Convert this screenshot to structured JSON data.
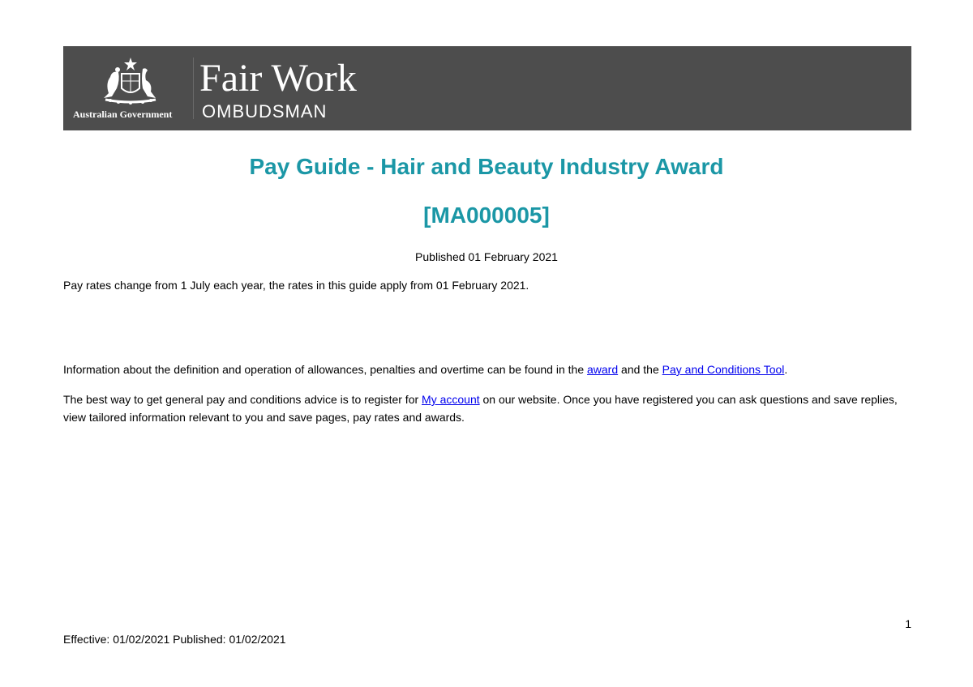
{
  "header": {
    "government_label": "Australian Government",
    "brand_line1": "Fair Work",
    "brand_line2": "OMBUDSMAN",
    "background_color": "#4d4d4d"
  },
  "title": {
    "line1": "Pay Guide - Hair and Beauty Industry Award",
    "line2": "[MA000005]",
    "color": "#1b97a6"
  },
  "published": "Published 01 February 2021",
  "paragraph1": "Pay rates change from 1 July each year, the rates in this guide apply from 01 February 2021.",
  "paragraph2": {
    "before": "Information about the definition and operation of allowances, penalties and overtime can be found in the ",
    "link1": "award",
    "middle": " and the ",
    "link2": "Pay and Conditions Tool",
    "after": "."
  },
  "paragraph3": {
    "before": "The best way to get general pay and conditions advice is to register for ",
    "link": "My account",
    "after": " on our website. Once you have registered you can ask questions and save replies, view tailored information relevant to you and save pages, pay rates and awards."
  },
  "page_number": "1",
  "footer": "Effective: 01/02/2021 Published: 01/02/2021"
}
